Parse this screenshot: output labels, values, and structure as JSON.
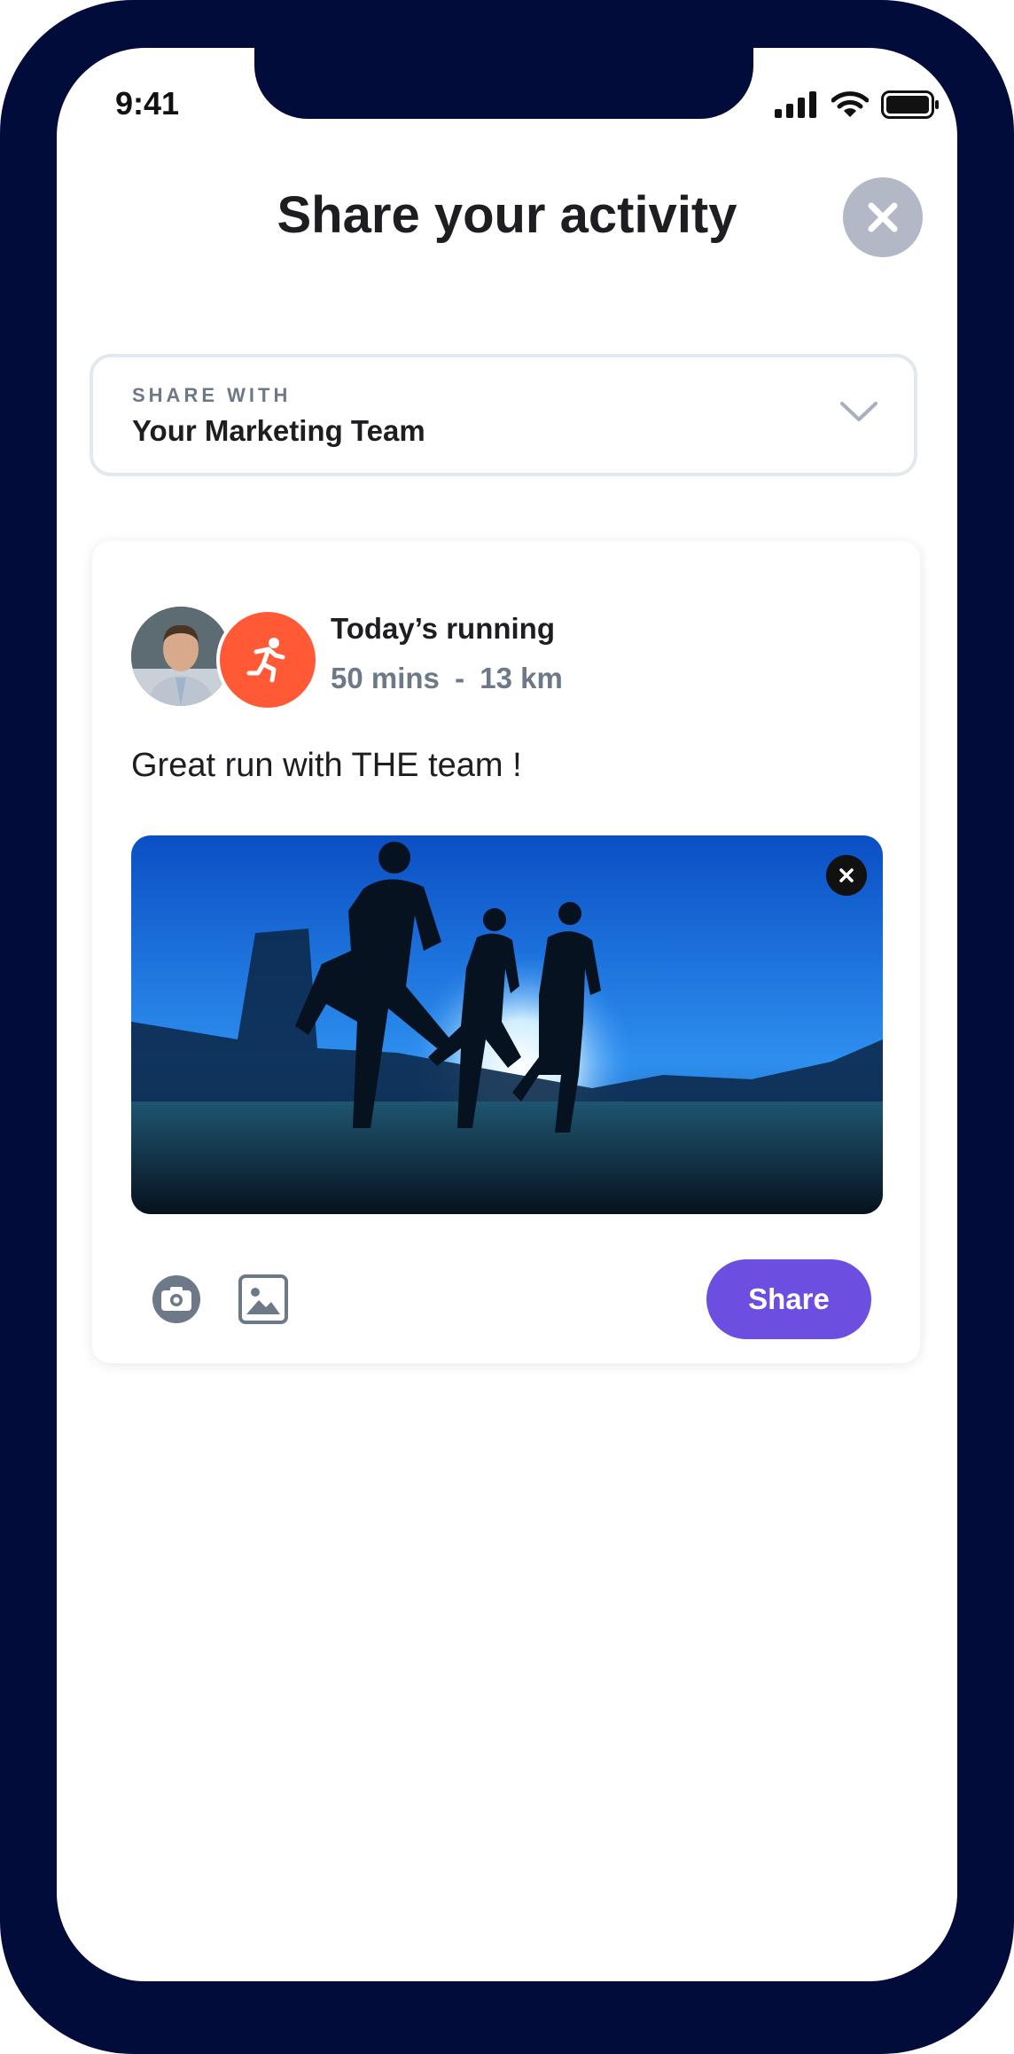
{
  "status_bar": {
    "time": "9:41"
  },
  "header": {
    "title": "Share your activity"
  },
  "share_with": {
    "label": "SHARE WITH",
    "value": "Your Marketing Team"
  },
  "activity": {
    "title": "Today’s running",
    "duration": "50 mins",
    "separator": "-",
    "distance": "13 km"
  },
  "post": {
    "text": "Great run with THE team !"
  },
  "actions": {
    "share_label": "Share"
  },
  "icons": [
    "close-icon",
    "chevron-down-icon",
    "running-icon",
    "camera-icon",
    "image-icon",
    "signal-icon",
    "wifi-icon",
    "battery-icon"
  ],
  "colors": {
    "frame": "#020c3a",
    "accent": "#6c4fe0",
    "run_badge": "#ff5a35",
    "muted": "#6d7889"
  }
}
